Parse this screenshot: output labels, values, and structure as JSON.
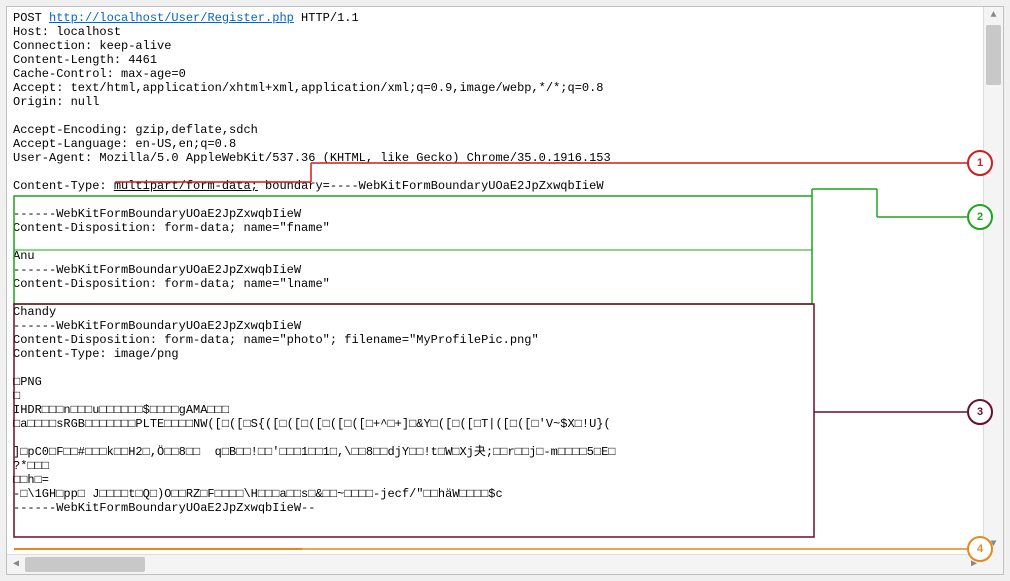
{
  "request": {
    "method": "POST ",
    "url": "http://localhost/User/Register.php",
    "protocol": " HTTP/1.1"
  },
  "headers": {
    "host": "Host: localhost",
    "connection": "Connection: keep-alive",
    "content_length": "Content-Length: 4461",
    "cache_control": "Cache-Control: max-age=0",
    "accept": "Accept: text/html,application/xhtml+xml,application/xml;q=0.9,image/webp,*/*;q=0.8",
    "origin": "Origin: null",
    "accept_encoding": "Accept-Encoding: gzip,deflate,sdch",
    "accept_language": "Accept-Language: en-US,en;q=0.8",
    "user_agent": "User-Agent: Mozilla/5.0 AppleWebKit/537.36 (KHTML, like Gecko) Chrome/35.0.1916.153",
    "content_type_prefix": "Content-Type: ",
    "content_type_underlined": "multipart/form-data;",
    "content_type_suffix": " boundary=----WebKitFormBoundaryUOaE2JpZxwqbIieW"
  },
  "body": {
    "b1": "------WebKitFormBoundaryUOaE2JpZxwqbIieW",
    "cd_fname": "Content-Disposition: form-data; name=\"fname\"",
    "blank1": "",
    "fname_val": "Anu",
    "b2": "------WebKitFormBoundaryUOaE2JpZxwqbIieW",
    "cd_lname": "Content-Disposition: form-data; name=\"lname\"",
    "blank2": "",
    "lname_val": "Chandy",
    "b3": "------WebKitFormBoundaryUOaE2JpZxwqbIieW",
    "cd_photo": "Content-Disposition: form-data; name=\"photo\"; filename=\"MyProfilePic.png\"",
    "ct_photo": "Content-Type: image/png",
    "blank3": "",
    "png1": "□PNG",
    "png2": "□",
    "png3": "IHDR□□□n□□□u□□□□□□$□□□□gAMA□□□",
    "png4": "□a□□□□sRGB□□□□□□□PLTE□□□□NW([□([□S{([□([□([□([□([□+^□+]□&Y□([□([□T|([□([□'V~$X□!U}(",
    "blank4": "",
    "png5": "]□pC0□F□□#□□□k□□H2□,Ö□□8□□  q□B□□!□□'□□□1□□1□,\\□□8□□djY□□!t□W□Xj夬;□□r□□j□-m□□□□5□E□",
    "png6": "?*□□□",
    "png7": "□□h□=",
    "png8": "-□\\1GH□pp□ J□□□□t□Q□)O□□RZ□F□□□□\\H□□□a□□s□&□□~□□□□-jecf/\"□□häW□□□□$c",
    "b4": "------WebKitFormBoundaryUOaE2JpZxwqbIieW--"
  },
  "callouts": {
    "c1": {
      "label": "1",
      "color": "#d01c1c"
    },
    "c2": {
      "label": "2",
      "color": "#1da61d"
    },
    "c3": {
      "label": "3",
      "color": "#6a0f2a"
    },
    "c4": {
      "label": "4",
      "color": "#e28a1e"
    }
  }
}
